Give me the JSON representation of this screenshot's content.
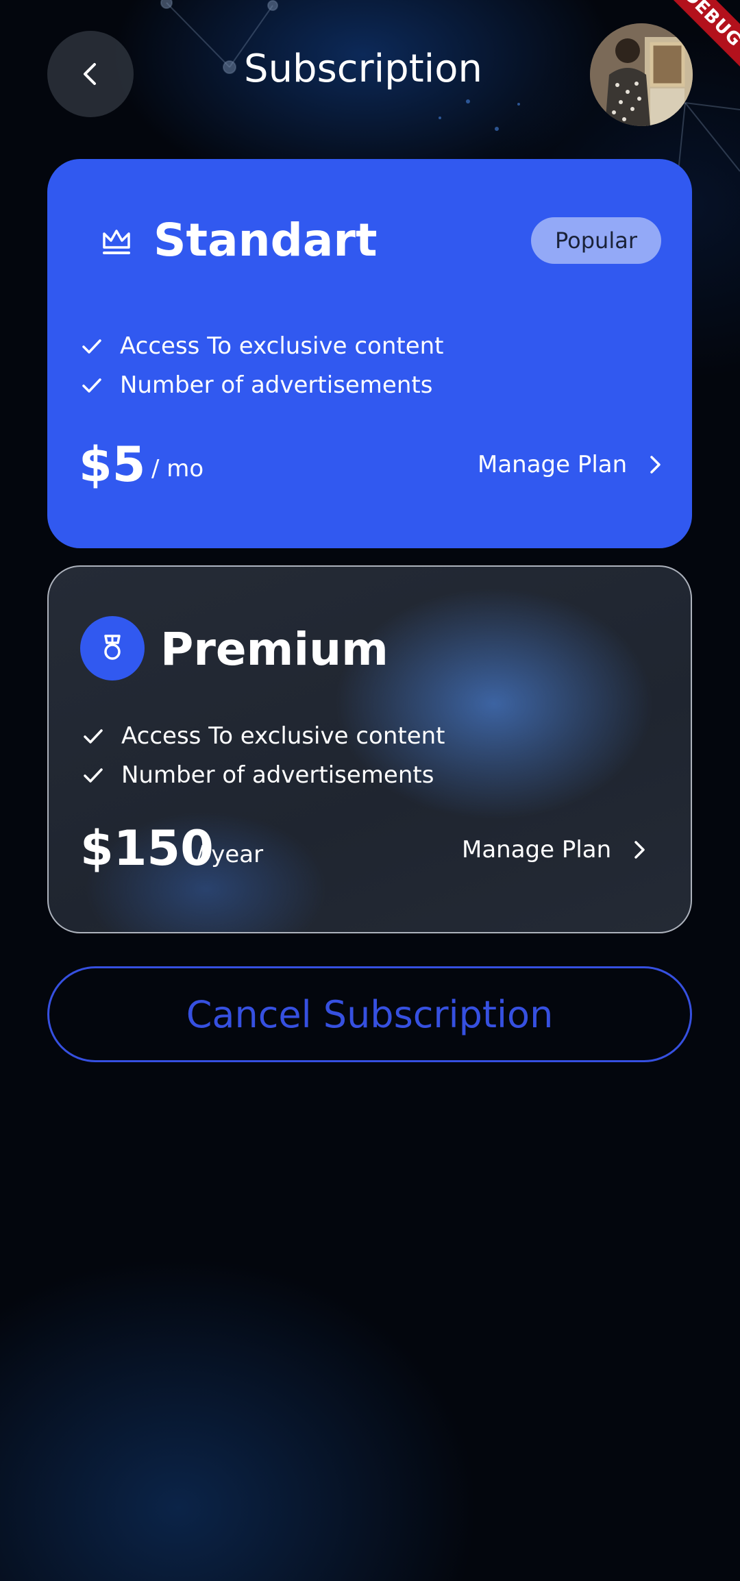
{
  "header": {
    "title": "Subscription",
    "back_icon": "chevron-left-icon",
    "avatar_icon": "user-avatar"
  },
  "debug_banner": "DEBUG",
  "plans": [
    {
      "name": "Standart",
      "icon": "crown-icon",
      "badge": "Popular",
      "features": [
        "Access To exclusive content",
        "Number of advertisements"
      ],
      "price": "$5",
      "period": "/ mo",
      "manage_label": "Manage Plan",
      "color": "#3159f0"
    },
    {
      "name": "Premium",
      "icon": "medal-icon",
      "features": [
        "Access To exclusive content",
        "Number of advertisements"
      ],
      "price": "$150",
      "period": "/ year",
      "manage_label": "Manage Plan",
      "color": "#232936"
    }
  ],
  "cancel_button": {
    "label": "Cancel Subscription",
    "color": "#3650e0"
  }
}
